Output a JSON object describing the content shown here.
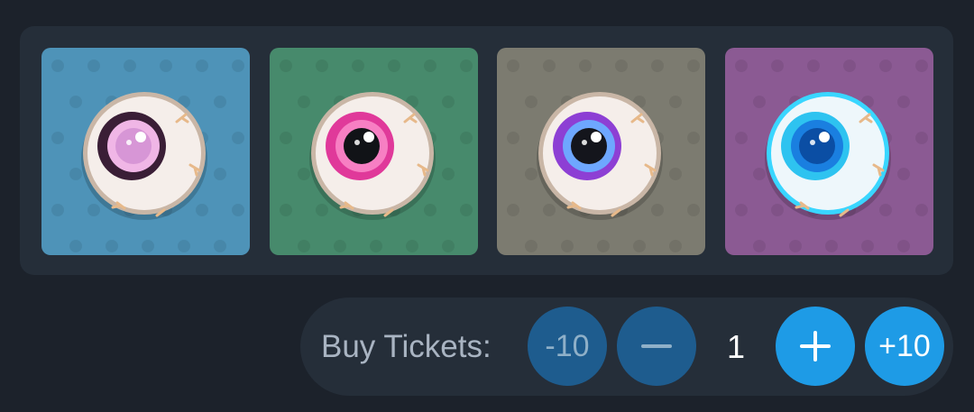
{
  "skins": [
    {
      "name": "pink-eyeball",
      "bg": "#4e93b8",
      "iris_outer": "#3a1e36",
      "iris_inner": "#f0b6e6",
      "pupil": "#d796d6",
      "rim": "#c9b6a6",
      "sclera": "#f5eeea"
    },
    {
      "name": "magenta-eyeball",
      "bg": "#478a6c",
      "iris_outer": "#e0399a",
      "iris_inner": "#f77fc3",
      "pupil": "#111317",
      "rim": "#c9b6a6",
      "sclera": "#f5eeea"
    },
    {
      "name": "violet-eyeball",
      "bg": "#7c7b70",
      "iris_outer": "#8d3fd4",
      "iris_inner": "#6ea7ff",
      "pupil": "#14151c",
      "rim": "#c9b6a6",
      "sclera": "#f5eeea"
    },
    {
      "name": "cyan-eyeball",
      "bg": "#8b5a93",
      "iris_outer": "#2ec3f0",
      "iris_inner": "#1a7fe0",
      "pupil": "#0b4ea4",
      "rim": "#39d6ff",
      "sclera": "#eef7fb"
    }
  ],
  "purchase": {
    "label": "Buy Tickets:",
    "minus_ten": "-10",
    "quantity": "1",
    "plus_ten": "+10"
  },
  "colors": {
    "background": "#1c222b",
    "panel": "#252e39",
    "button_dim": "#1e5c8e",
    "button_bright": "#1e9be6"
  }
}
